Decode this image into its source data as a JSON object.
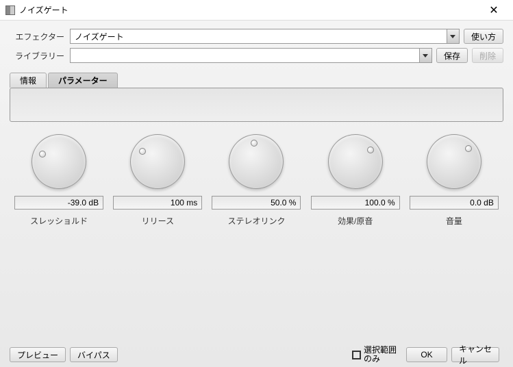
{
  "window": {
    "title": "ノイズゲート"
  },
  "header": {
    "effector_label": "エフェクター",
    "effector_value": "ノイズゲート",
    "library_label": "ライブラリー",
    "library_value": "",
    "help_btn": "使い方",
    "save_btn": "保存",
    "delete_btn": "削除"
  },
  "tabs": {
    "info": "情報",
    "params": "パラメーター"
  },
  "knobs": [
    {
      "label": "スレッショルド",
      "value": "-39.0 dB",
      "angle": -65
    },
    {
      "label": "リリース",
      "value": "100 ms",
      "angle": -55
    },
    {
      "label": "ステレオリンク",
      "value": "50.0 %",
      "angle": -10
    },
    {
      "label": "効果/原音",
      "value": "100.0 %",
      "angle": 50
    },
    {
      "label": "音量",
      "value": "0.0 dB",
      "angle": 45
    }
  ],
  "footer": {
    "preview": "プレビュー",
    "bypass": "バイパス",
    "selection_only": "選択範囲\nのみ",
    "ok": "OK",
    "cancel": "キャンセル"
  }
}
